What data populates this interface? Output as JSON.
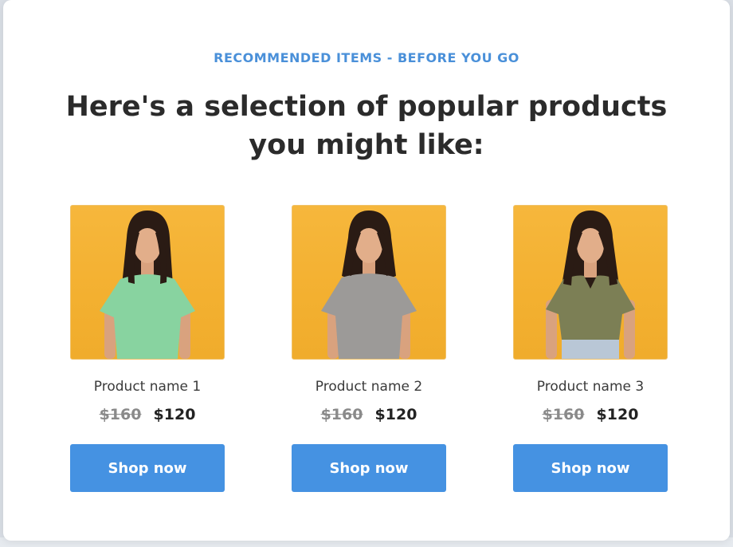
{
  "eyebrow": "RECOMMENDED ITEMS - BEFORE YOU GO",
  "headline": "Here's a selection of popular products you might like:",
  "products": [
    {
      "name": "Product name 1",
      "old_price": "$160",
      "new_price": "$120",
      "button_label": "Shop now",
      "shirt_color": "#88d3a0",
      "pants_color": "#88d3a0"
    },
    {
      "name": "Product name 2",
      "old_price": "$160",
      "new_price": "$120",
      "button_label": "Shop now",
      "shirt_color": "#9c9a98",
      "pants_color": "#9c9a98"
    },
    {
      "name": "Product name 3",
      "old_price": "$160",
      "new_price": "$120",
      "button_label": "Shop now",
      "shirt_color": "#7c7f55",
      "pants_color": "#b9c7d6"
    }
  ],
  "colors": {
    "accent": "#4592e2",
    "eyebrow": "#4a90d9",
    "image_background": "#f3b030"
  }
}
